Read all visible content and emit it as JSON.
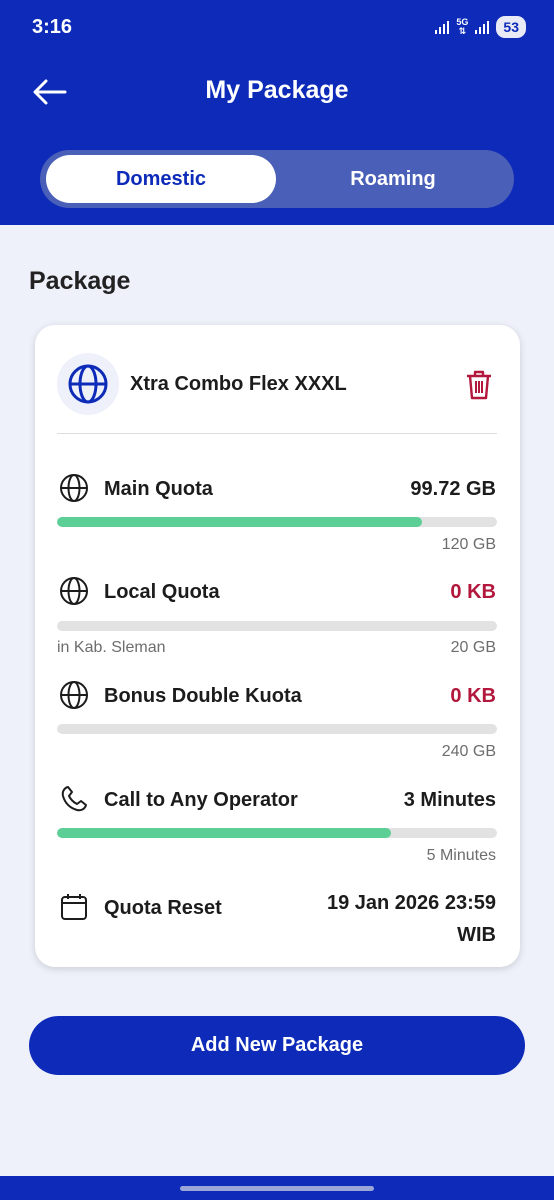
{
  "status_bar": {
    "time": "3:16",
    "network": "5G",
    "battery": "53"
  },
  "header": {
    "title": "My Package"
  },
  "tabs": [
    {
      "label": "Domestic",
      "active": true
    },
    {
      "label": "Roaming",
      "active": false
    }
  ],
  "section_title": "Package",
  "package": {
    "name": "Xtra Combo Flex XXXL",
    "quotas": [
      {
        "label": "Main Quota",
        "value": "99.72 GB",
        "total": "120 GB",
        "note": "",
        "progress": 0.83
      },
      {
        "label": "Local Quota",
        "value": "0 KB",
        "total": "20 GB",
        "note": "in Kab. Sleman",
        "progress": 0
      },
      {
        "label": "Bonus Double Kuota",
        "value": "0 KB",
        "total": "240 GB",
        "note": "",
        "progress": 0
      },
      {
        "label": "Call to Any Operator",
        "value": "3 Minutes",
        "total": "5 Minutes",
        "note": "",
        "progress": 0.76
      }
    ],
    "reset": {
      "label": "Quota Reset",
      "date": "19 Jan 2026 23:59",
      "timezone": "WIB"
    }
  },
  "add_button_label": "Add New Package",
  "colors": {
    "primary": "#0d2bb8",
    "progress": "#5ccf96",
    "alert": "#b2173c"
  },
  "icons": {
    "back": "arrow-left-icon",
    "package": "globe-icon",
    "delete": "trash-icon",
    "quota": "globe-icon",
    "call": "phone-icon",
    "reset": "calendar-icon"
  }
}
